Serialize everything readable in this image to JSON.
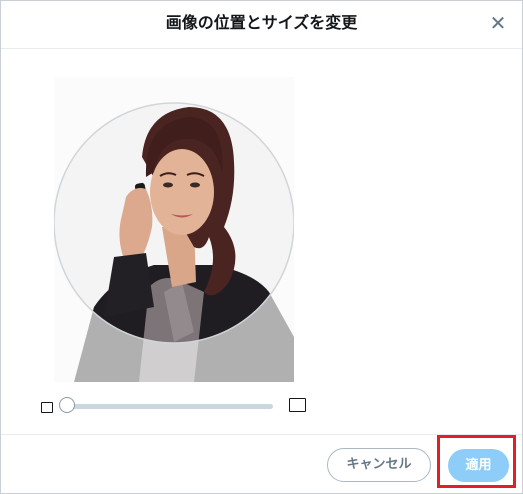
{
  "dialog": {
    "title": "画像の位置とサイズを変更",
    "close_glyph": "✕"
  },
  "zoom": {
    "level": 0
  },
  "footer": {
    "cancel_label": "キャンセル",
    "apply_label": "適用"
  },
  "colors": {
    "apply_button": "#8ecdf8",
    "highlight_border": "#e01f26",
    "slider_track": "#ccd6dd"
  },
  "icons": {
    "close": "close-icon",
    "zoom_out": "small-image-icon",
    "zoom_in": "large-image-icon"
  }
}
